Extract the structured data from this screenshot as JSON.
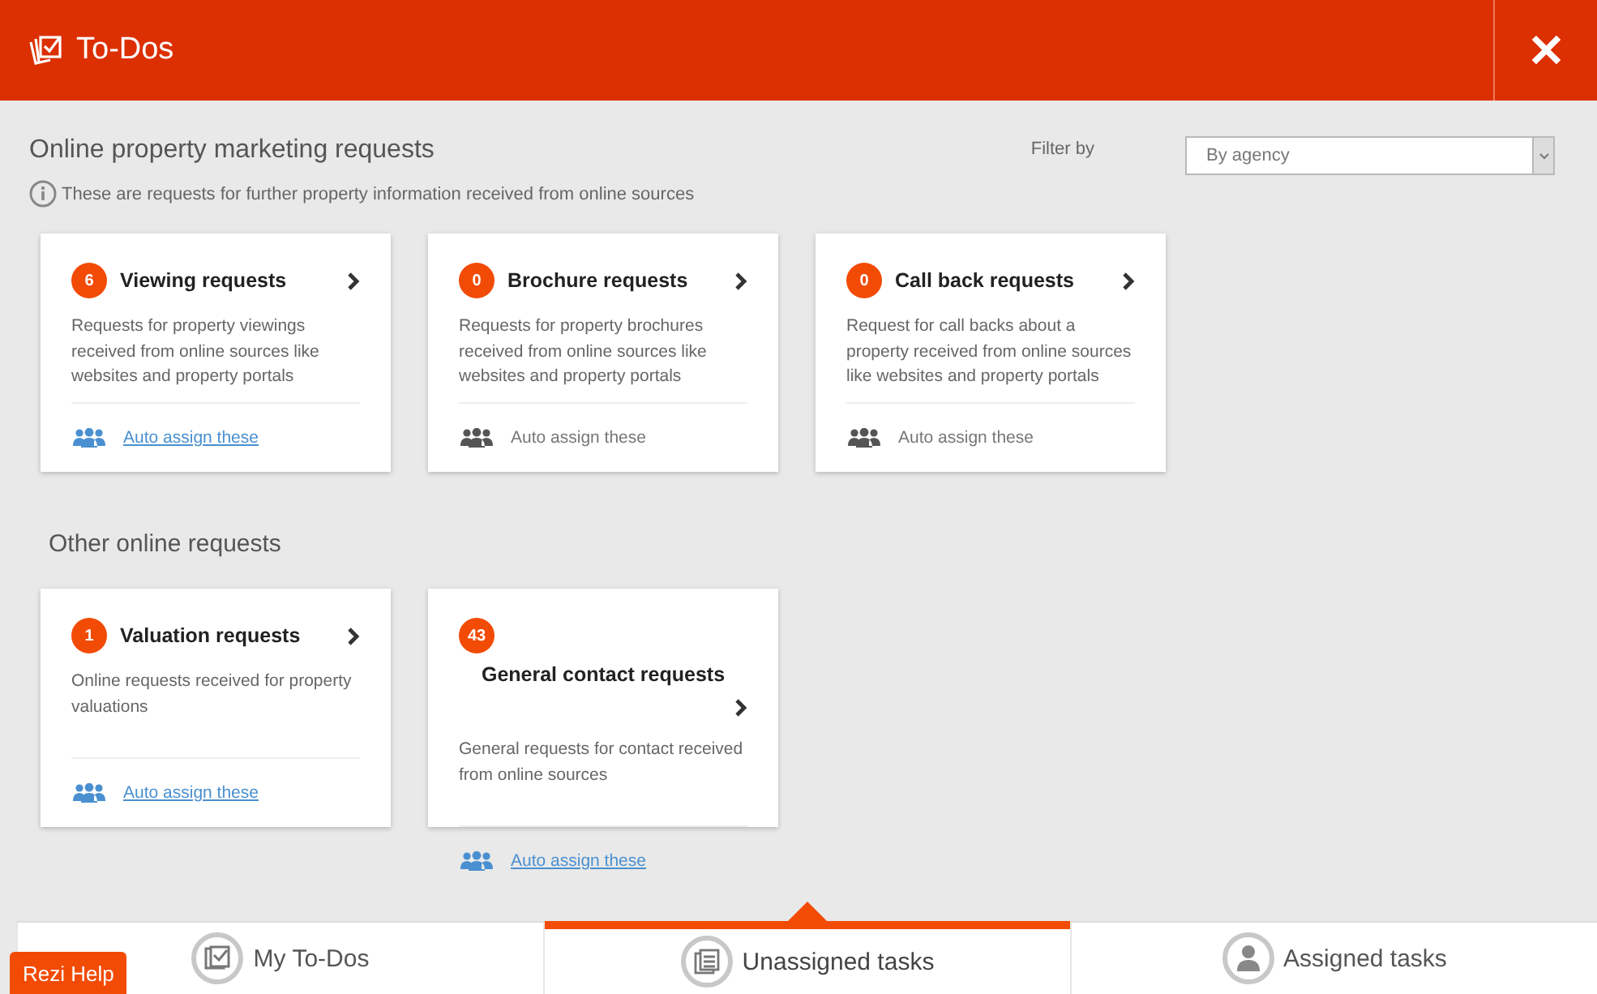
{
  "header": {
    "title": "To-Dos",
    "close_label": "✕"
  },
  "filter": {
    "label": "Filter by",
    "value": "By agency"
  },
  "sections": [
    {
      "title": "Online property marketing requests",
      "info": "These are requests for further property information received from online sources",
      "cards": [
        {
          "count": "6",
          "title": "Viewing requests",
          "description": "Requests for property viewings received from online sources like websites and property portals",
          "action": "Auto assign these",
          "action_enabled": true
        },
        {
          "count": "0",
          "title": "Brochure requests",
          "description": "Requests for property brochures received from online sources like websites and property portals",
          "action": "Auto assign these",
          "action_enabled": false
        },
        {
          "count": "0",
          "title": "Call back requests",
          "description": "Request for call backs about a property received from online sources like websites and property portals",
          "action": "Auto assign these",
          "action_enabled": false
        }
      ]
    },
    {
      "title": "Other online requests",
      "cards": [
        {
          "count": "1",
          "title": "Valuation requests",
          "description": "Online requests received for property valuations",
          "action": "Auto assign these",
          "action_enabled": true
        },
        {
          "count": "43",
          "title": "General contact requests",
          "description": "General requests for contact received from online sources",
          "action": "Auto assign these",
          "action_enabled": true,
          "kind": "wide"
        }
      ]
    }
  ],
  "tabs": [
    {
      "label": "My To-Dos",
      "selected": false,
      "kind": "mine"
    },
    {
      "label": "Unassigned tasks",
      "selected": true,
      "kind": "unassigned"
    },
    {
      "label": "Assigned tasks",
      "selected": false,
      "kind": "assigned"
    }
  ],
  "help_button": "Rezi Help"
}
